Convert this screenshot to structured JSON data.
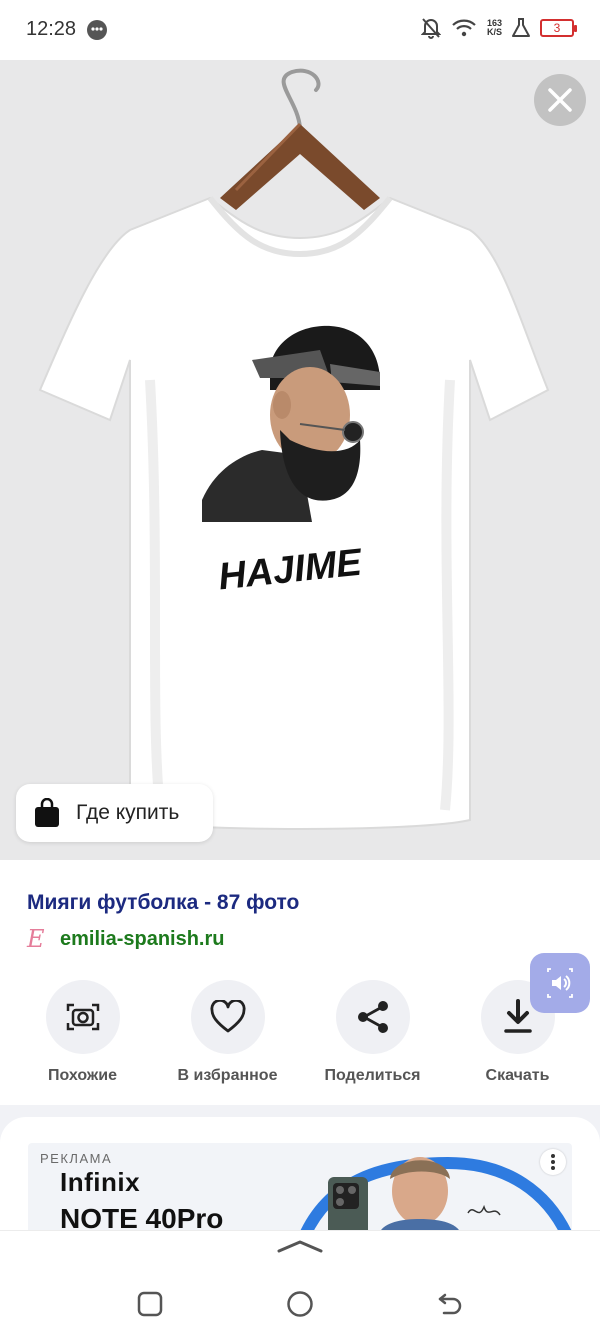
{
  "status_bar": {
    "time": "12:28",
    "network_speed_value": "163",
    "network_speed_unit": "K/S",
    "battery_level": "3"
  },
  "product": {
    "print_text": "HAJIME",
    "where_to_buy_label": "Где купить"
  },
  "result": {
    "title": "Мияги футболка - 87 фото",
    "source_domain": "emilia-spanish.ru",
    "source_logo": "E"
  },
  "actions": [
    {
      "icon": "camera-search-icon",
      "label": "Похожие"
    },
    {
      "icon": "heart-icon",
      "label": "В избранное"
    },
    {
      "icon": "share-icon",
      "label": "Поделиться"
    },
    {
      "icon": "download-icon",
      "label": "Скачать"
    }
  ],
  "ad": {
    "label": "РЕКЛАМА",
    "brand": "Infinix",
    "model": "NOTE 40Pro"
  },
  "colors": {
    "title": "#1c2a80",
    "source_domain": "#1d7a1d",
    "sound_button": "#a3abe8",
    "battery_low": "#d32f2f"
  }
}
